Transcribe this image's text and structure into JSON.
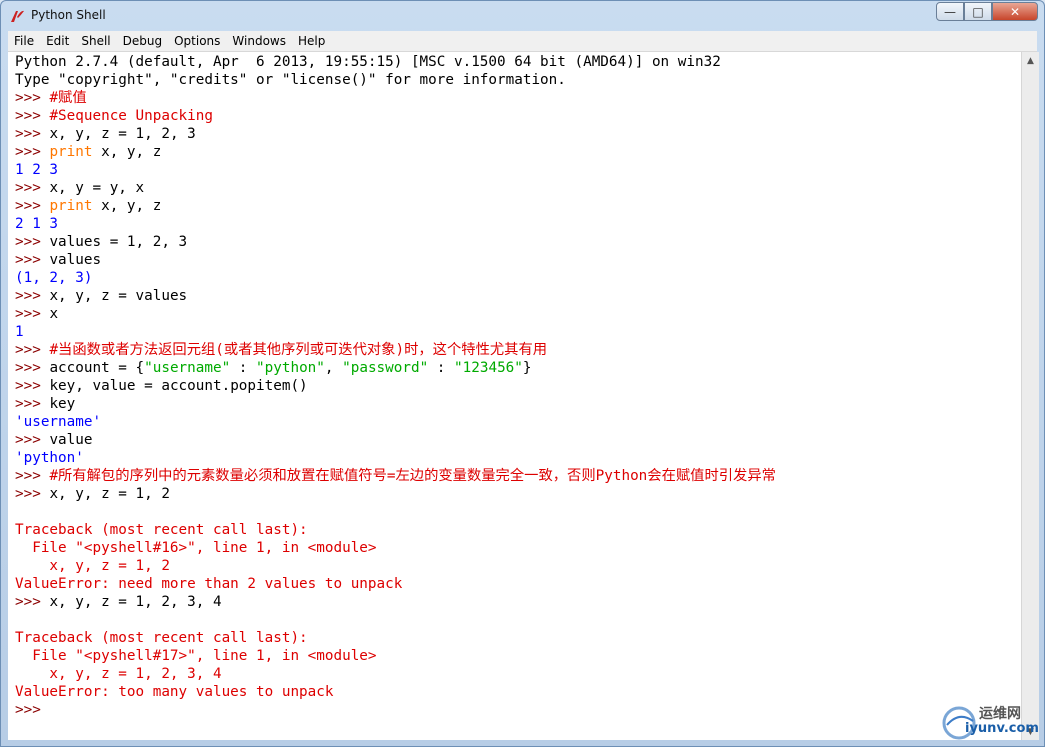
{
  "window": {
    "title": "Python Shell"
  },
  "menu": [
    "File",
    "Edit",
    "Shell",
    "Debug",
    "Options",
    "Windows",
    "Help"
  ],
  "colors": {
    "prompt": "#8b0000",
    "output": "#0000ff",
    "keyword": "#ff7700",
    "string": "#00aa00",
    "comment": "#dd0000",
    "error": "#dd0000",
    "default": "#000000"
  },
  "shell_lines": [
    [
      {
        "t": "Python 2.7.4 (default, Apr  6 2013, 19:55:15) [MSC v.1500 64 bit (AMD64)] on win32",
        "c": "default"
      }
    ],
    [
      {
        "t": "Type \"copyright\", \"credits\" or \"license()\" for more information.",
        "c": "default"
      }
    ],
    [
      {
        "t": ">>> ",
        "c": "prompt"
      },
      {
        "t": "#赋值",
        "c": "comment"
      }
    ],
    [
      {
        "t": ">>> ",
        "c": "prompt"
      },
      {
        "t": "#Sequence Unpacking",
        "c": "comment"
      }
    ],
    [
      {
        "t": ">>> ",
        "c": "prompt"
      },
      {
        "t": "x, y, z = 1, 2, 3",
        "c": "default"
      }
    ],
    [
      {
        "t": ">>> ",
        "c": "prompt"
      },
      {
        "t": "print",
        "c": "keyword"
      },
      {
        "t": " x, y, z",
        "c": "default"
      }
    ],
    [
      {
        "t": "1 2 3",
        "c": "output"
      }
    ],
    [
      {
        "t": ">>> ",
        "c": "prompt"
      },
      {
        "t": "x, y = y, x",
        "c": "default"
      }
    ],
    [
      {
        "t": ">>> ",
        "c": "prompt"
      },
      {
        "t": "print",
        "c": "keyword"
      },
      {
        "t": " x, y, z",
        "c": "default"
      }
    ],
    [
      {
        "t": "2 1 3",
        "c": "output"
      }
    ],
    [
      {
        "t": ">>> ",
        "c": "prompt"
      },
      {
        "t": "values = 1, 2, 3",
        "c": "default"
      }
    ],
    [
      {
        "t": ">>> ",
        "c": "prompt"
      },
      {
        "t": "values",
        "c": "default"
      }
    ],
    [
      {
        "t": "(1, 2, 3)",
        "c": "output"
      }
    ],
    [
      {
        "t": ">>> ",
        "c": "prompt"
      },
      {
        "t": "x, y, z = values",
        "c": "default"
      }
    ],
    [
      {
        "t": ">>> ",
        "c": "prompt"
      },
      {
        "t": "x",
        "c": "default"
      }
    ],
    [
      {
        "t": "1",
        "c": "output"
      }
    ],
    [
      {
        "t": ">>> ",
        "c": "prompt"
      },
      {
        "t": "#当函数或者方法返回元组(或者其他序列或可迭代对象)时，这个特性尤其有用",
        "c": "comment"
      }
    ],
    [
      {
        "t": ">>> ",
        "c": "prompt"
      },
      {
        "t": "account = {",
        "c": "default"
      },
      {
        "t": "\"username\"",
        "c": "string"
      },
      {
        "t": " : ",
        "c": "default"
      },
      {
        "t": "\"python\"",
        "c": "string"
      },
      {
        "t": ", ",
        "c": "default"
      },
      {
        "t": "\"password\"",
        "c": "string"
      },
      {
        "t": " : ",
        "c": "default"
      },
      {
        "t": "\"123456\"",
        "c": "string"
      },
      {
        "t": "}",
        "c": "default"
      }
    ],
    [
      {
        "t": ">>> ",
        "c": "prompt"
      },
      {
        "t": "key, value = account.popitem()",
        "c": "default"
      }
    ],
    [
      {
        "t": ">>> ",
        "c": "prompt"
      },
      {
        "t": "key",
        "c": "default"
      }
    ],
    [
      {
        "t": "'username'",
        "c": "output"
      }
    ],
    [
      {
        "t": ">>> ",
        "c": "prompt"
      },
      {
        "t": "value",
        "c": "default"
      }
    ],
    [
      {
        "t": "'python'",
        "c": "output"
      }
    ],
    [
      {
        "t": ">>> ",
        "c": "prompt"
      },
      {
        "t": "#所有解包的序列中的元素数量必须和放置在赋值符号=左边的变量数量完全一致，否则Python会在赋值时引发异常",
        "c": "comment"
      }
    ],
    [
      {
        "t": ">>> ",
        "c": "prompt"
      },
      {
        "t": "x, y, z = 1, 2",
        "c": "default"
      }
    ],
    [],
    [
      {
        "t": "Traceback (most recent call last):",
        "c": "error"
      }
    ],
    [
      {
        "t": "  File \"<pyshell#16>\", line 1, in <module>",
        "c": "error"
      }
    ],
    [
      {
        "t": "    x, y, z = 1, 2",
        "c": "error"
      }
    ],
    [
      {
        "t": "ValueError: need more than 2 values to unpack",
        "c": "error"
      }
    ],
    [
      {
        "t": ">>> ",
        "c": "prompt"
      },
      {
        "t": "x, y, z = 1, 2, 3, 4",
        "c": "default"
      }
    ],
    [],
    [
      {
        "t": "Traceback (most recent call last):",
        "c": "error"
      }
    ],
    [
      {
        "t": "  File \"<pyshell#17>\", line 1, in <module>",
        "c": "error"
      }
    ],
    [
      {
        "t": "    x, y, z = 1, 2, 3, 4",
        "c": "error"
      }
    ],
    [
      {
        "t": "ValueError: too many values to unpack",
        "c": "error"
      }
    ],
    [
      {
        "t": ">>> ",
        "c": "prompt"
      }
    ]
  ],
  "watermark": {
    "line1": "运维网",
    "line2": "iyunv.com"
  }
}
